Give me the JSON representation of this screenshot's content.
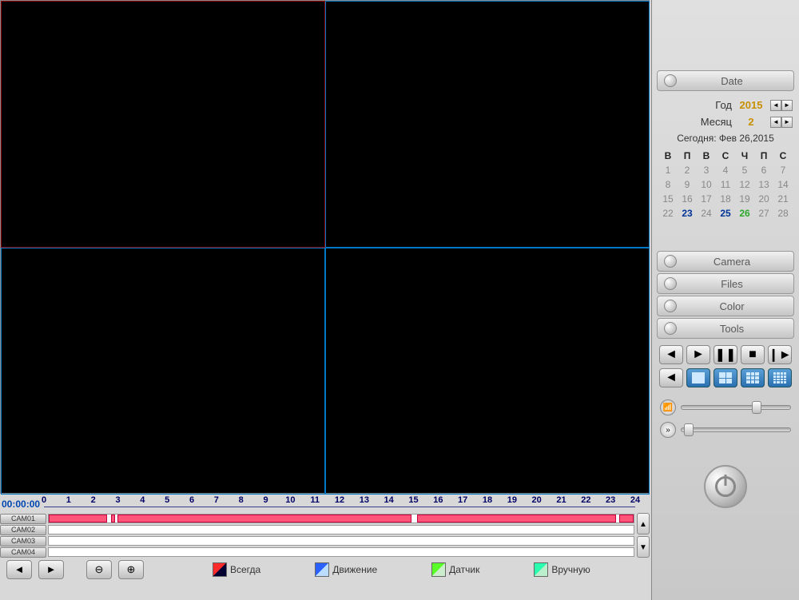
{
  "timeline": {
    "current_time": "00:00:00",
    "hours": [
      "0",
      "1",
      "2",
      "3",
      "4",
      "5",
      "6",
      "7",
      "8",
      "9",
      "10",
      "11",
      "12",
      "13",
      "14",
      "15",
      "16",
      "17",
      "18",
      "19",
      "20",
      "21",
      "22",
      "23",
      "24"
    ]
  },
  "cameras": [
    "CAM01",
    "CAM02",
    "CAM03",
    "CAM04"
  ],
  "legend": {
    "always": "Всегда",
    "motion": "Движение",
    "sensor": "Датчик",
    "manual": "Вручную"
  },
  "sidebar": {
    "date_header": "Date",
    "year_label": "Год",
    "year_value": "2015",
    "month_label": "Месяц",
    "month_value": "2",
    "today_label": "Сегодня: Фев 26,2015",
    "weekdays": [
      "В",
      "П",
      "В",
      "С",
      "Ч",
      "П",
      "С"
    ],
    "calendar": [
      [
        {
          "d": "1"
        },
        {
          "d": "2"
        },
        {
          "d": "3"
        },
        {
          "d": "4"
        },
        {
          "d": "5"
        },
        {
          "d": "6"
        },
        {
          "d": "7"
        }
      ],
      [
        {
          "d": "8"
        },
        {
          "d": "9"
        },
        {
          "d": "10"
        },
        {
          "d": "11"
        },
        {
          "d": "12"
        },
        {
          "d": "13"
        },
        {
          "d": "14"
        }
      ],
      [
        {
          "d": "15"
        },
        {
          "d": "16"
        },
        {
          "d": "17"
        },
        {
          "d": "18"
        },
        {
          "d": "19"
        },
        {
          "d": "20"
        },
        {
          "d": "21"
        }
      ],
      [
        {
          "d": "22"
        },
        {
          "d": "23",
          "cls": "active"
        },
        {
          "d": "24"
        },
        {
          "d": "25",
          "cls": "active"
        },
        {
          "d": "26",
          "cls": "today"
        },
        {
          "d": "27"
        },
        {
          "d": "28"
        }
      ]
    ],
    "camera_header": "Camera",
    "files_header": "Files",
    "color_header": "Color",
    "tools_header": "Tools"
  }
}
